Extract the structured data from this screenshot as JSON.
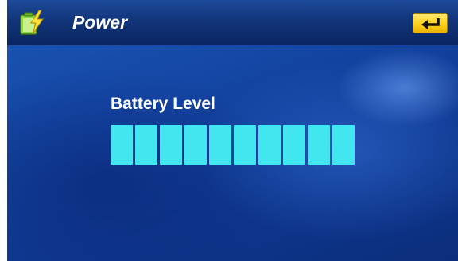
{
  "window": {
    "title": "Power",
    "app_icon": "battery-charging-icon",
    "back_icon": "return-arrow-icon"
  },
  "battery": {
    "label": "Battery Level",
    "level_fraction": 1.0,
    "segments_total": 10,
    "segments_filled": 10
  },
  "colors": {
    "background": "#1547a6",
    "titlebar": "#12357a",
    "segment": "#41e6ee",
    "back_button": "#ffd21a"
  }
}
